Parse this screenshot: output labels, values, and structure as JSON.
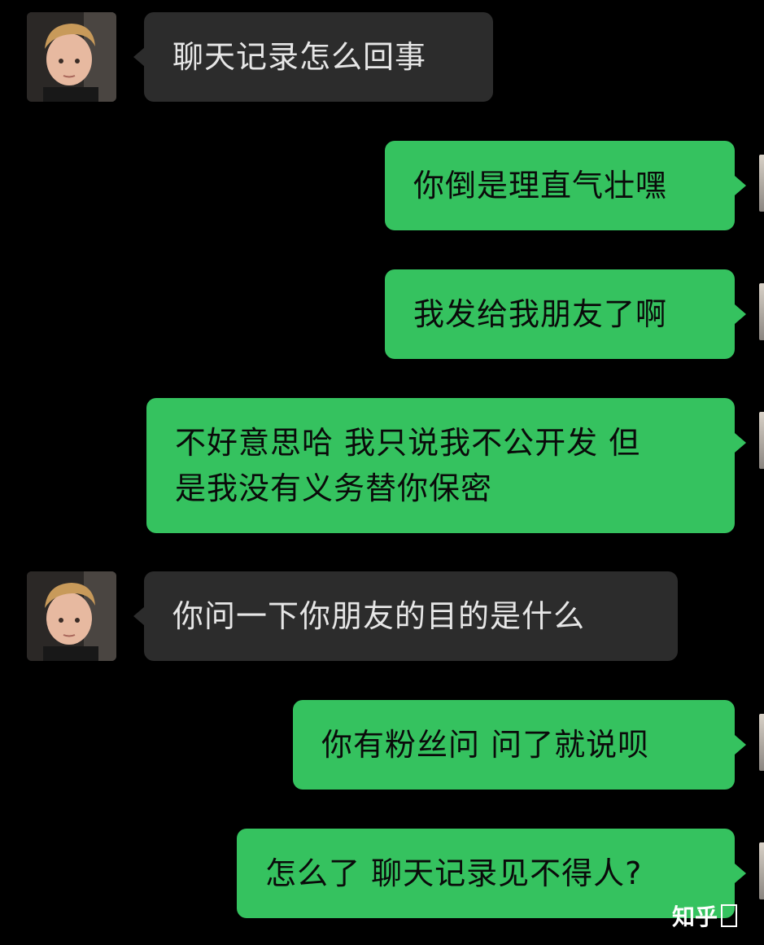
{
  "chat": {
    "messages": [
      {
        "side": "left",
        "text": "聊天记录怎么回事"
      },
      {
        "side": "right",
        "text": "你倒是理直气壮嘿"
      },
      {
        "side": "right",
        "text": "我发给我朋友了啊"
      },
      {
        "side": "right",
        "text_line1": "不好意思哈 我只说我不公开发 但",
        "text_line2": "是我没有义务替你保密"
      },
      {
        "side": "left",
        "text": "你问一下你朋友的目的是什么"
      },
      {
        "side": "right",
        "text": "你有粉丝问 问了就说呗"
      },
      {
        "side": "right",
        "text": "怎么了 聊天记录见不得人?"
      }
    ],
    "colors": {
      "background": "#000000",
      "left_bubble": "#2c2c2c",
      "right_bubble": "#35c25f"
    }
  },
  "watermark": {
    "brand": "知乎",
    "icon": "zhihu-logo"
  }
}
